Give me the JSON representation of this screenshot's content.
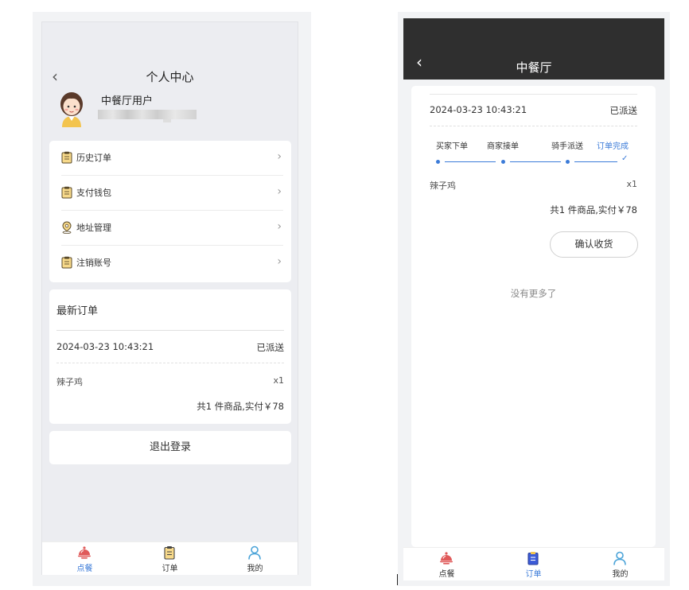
{
  "left": {
    "title": "个人中心",
    "back": "‹",
    "user": {
      "name": "中餐厅用户"
    },
    "menu": [
      {
        "label": "历史订单",
        "icon": "clipboard-icon"
      },
      {
        "label": "支付钱包",
        "icon": "clipboard-icon"
      },
      {
        "label": "地址管理",
        "icon": "location-pin-icon"
      },
      {
        "label": "注销账号",
        "icon": "clipboard-icon"
      }
    ],
    "chevron": "›",
    "latest_orders": {
      "title": "最新订单",
      "time": "2024-03-23 10:43:21",
      "status": "已派送",
      "item_name": "辣子鸡",
      "item_qty": "x1",
      "total": "共1 件商品,实付￥78"
    },
    "logout": "退出登录",
    "tabs": [
      {
        "label": "点餐",
        "icon": "cloche-icon",
        "active": true
      },
      {
        "label": "订单",
        "icon": "clipboard-icon",
        "active": false
      },
      {
        "label": "我的",
        "icon": "user-icon",
        "active": false
      }
    ]
  },
  "right": {
    "title": "中餐厅",
    "back": "‹",
    "order": {
      "time": "2024-03-23 10:43:21",
      "status": "已派送",
      "steps": [
        "买家下单",
        "商家接单",
        "骑手派送",
        "订单完成"
      ],
      "item_name": "辣子鸡",
      "item_qty": "x1",
      "total": "共1 件商品,实付￥78",
      "confirm": "确认收货"
    },
    "no_more": "没有更多了",
    "tabs": [
      {
        "label": "点餐",
        "icon": "cloche-icon",
        "active": false
      },
      {
        "label": "订单",
        "icon": "clipboard-icon",
        "active": true
      },
      {
        "label": "我的",
        "icon": "user-icon",
        "active": false
      }
    ]
  },
  "colors": {
    "accent": "#3b7bd8",
    "header_dark": "#2f2f2f",
    "cloche_red": "#e05a5a",
    "icon_yellow": "#e8b84a"
  }
}
